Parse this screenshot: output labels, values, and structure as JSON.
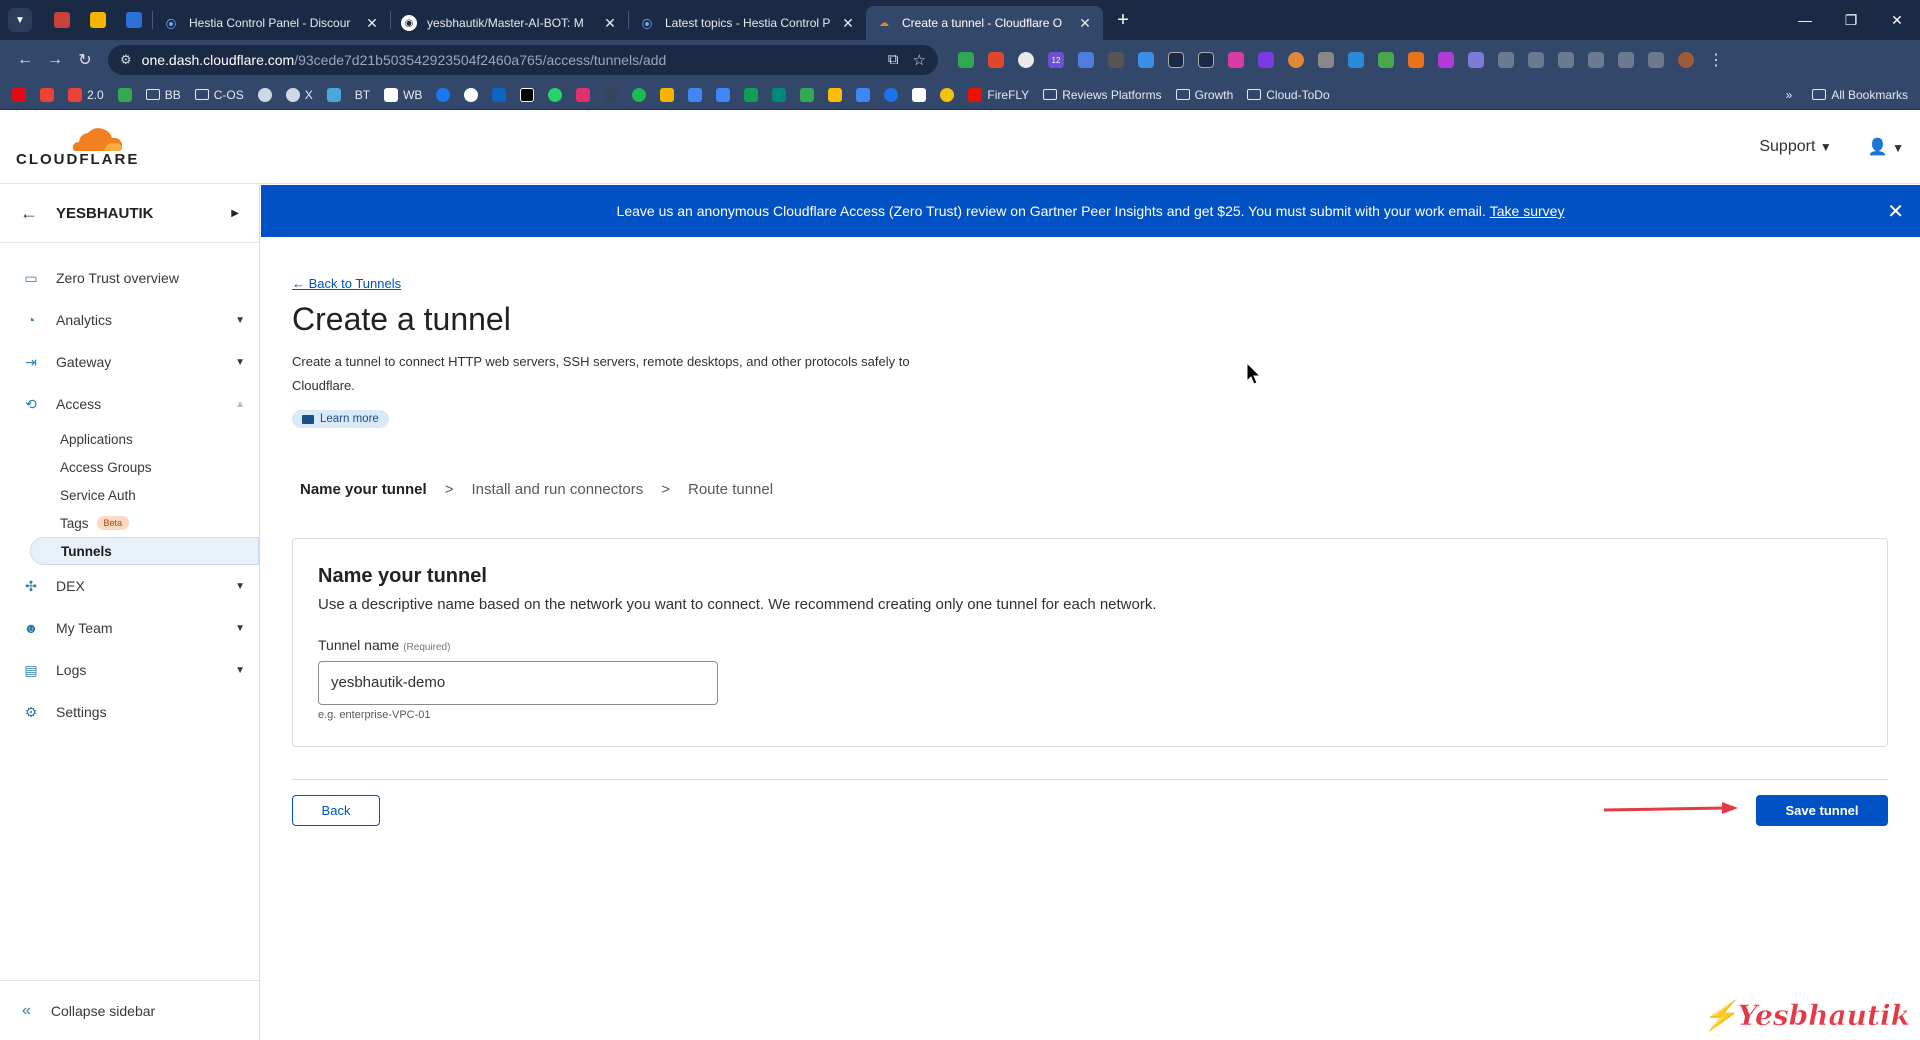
{
  "browser": {
    "tabs": [
      {
        "title": "Hestia Control Panel - Discour",
        "favicon_color": "#2d6fd8"
      },
      {
        "title": "yesbhautik/Master-AI-BOT: M",
        "favicon_color": "#ffffff"
      },
      {
        "title": "Latest topics - Hestia Control P",
        "favicon_color": "#2d6fd8"
      },
      {
        "title": "Create a tunnel - Cloudflare O",
        "favicon_color": "#f38020",
        "active": true
      }
    ],
    "url_host": "one.dash.cloudflare.com",
    "url_path": "/93cede7d21b503542923504f2460a765/access/tunnels/add",
    "ext_badge": "12",
    "bookmarks": [
      "2.0",
      "BB",
      "C-OS",
      "X",
      "BT",
      "WB",
      "FireFLY",
      "Reviews Platforms",
      "Growth",
      "Cloud-ToDo"
    ],
    "all_bookmarks": "All Bookmarks"
  },
  "header": {
    "logo_text": "CLOUDFLARE",
    "support": "Support"
  },
  "sidebar": {
    "account": "YESBHAUTIK",
    "items": [
      {
        "label": "Zero Trust overview"
      },
      {
        "label": "Analytics"
      },
      {
        "label": "Gateway"
      },
      {
        "label": "Access"
      },
      {
        "label": "DEX"
      },
      {
        "label": "My Team"
      },
      {
        "label": "Logs"
      },
      {
        "label": "Settings"
      }
    ],
    "access_sub": [
      "Applications",
      "Access Groups",
      "Service Auth",
      "Tags",
      "Tunnels"
    ],
    "beta_badge": "Beta",
    "collapse": "Collapse sidebar"
  },
  "banner": {
    "text": "Leave us an anonymous Cloudflare Access (Zero Trust) review on Gartner Peer Insights and get $25. You must submit with your work email.",
    "link": "Take survey"
  },
  "main": {
    "back_link": "← Back to Tunnels",
    "title": "Create a tunnel",
    "description": "Create a tunnel to connect HTTP web servers, SSH servers, remote desktops, and other protocols safely to Cloudflare.",
    "learn_more": "Learn more",
    "steps": [
      "Name your tunnel",
      "Install and run connectors",
      "Route tunnel"
    ],
    "card": {
      "heading": "Name your tunnel",
      "subtext": "Use a descriptive name based on the network you want to connect. We recommend creating only one tunnel for each network.",
      "field_label": "Tunnel name",
      "required": "(Required)",
      "value": "yesbhautik-demo",
      "hint": "e.g. enterprise-VPC-01"
    },
    "back_button": "Back",
    "save_button": "Save tunnel"
  },
  "watermark": "⚡Yesbhautik",
  "colors": {
    "accent": "#0051c3",
    "brand_orange": "#f38020",
    "arrow": "#e63946"
  }
}
